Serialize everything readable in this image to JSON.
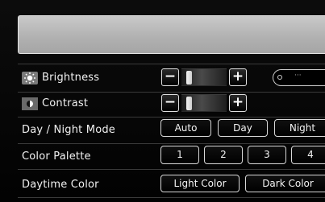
{
  "settings": {
    "brightness": {
      "label": "Brightness",
      "level": 0.08,
      "readout": "···"
    },
    "contrast": {
      "label": "Contrast",
      "level": 0.08
    },
    "day_night": {
      "label": "Day / Night Mode",
      "options": [
        "Auto",
        "Day",
        "Night"
      ]
    },
    "palette": {
      "label": "Color Palette",
      "options": [
        "1",
        "2",
        "3",
        "4"
      ]
    },
    "daytime_color": {
      "label": "Daytime Color",
      "options": [
        "Light Color",
        "Dark Color"
      ]
    }
  },
  "controls": {
    "minus": "−",
    "plus": "+"
  },
  "icons": {
    "brightness": "sun-icon",
    "contrast": "contrast-icon"
  },
  "colors": {
    "background": "#050505",
    "header_box": "#bdbdbd",
    "border": "#d8d8d8"
  }
}
